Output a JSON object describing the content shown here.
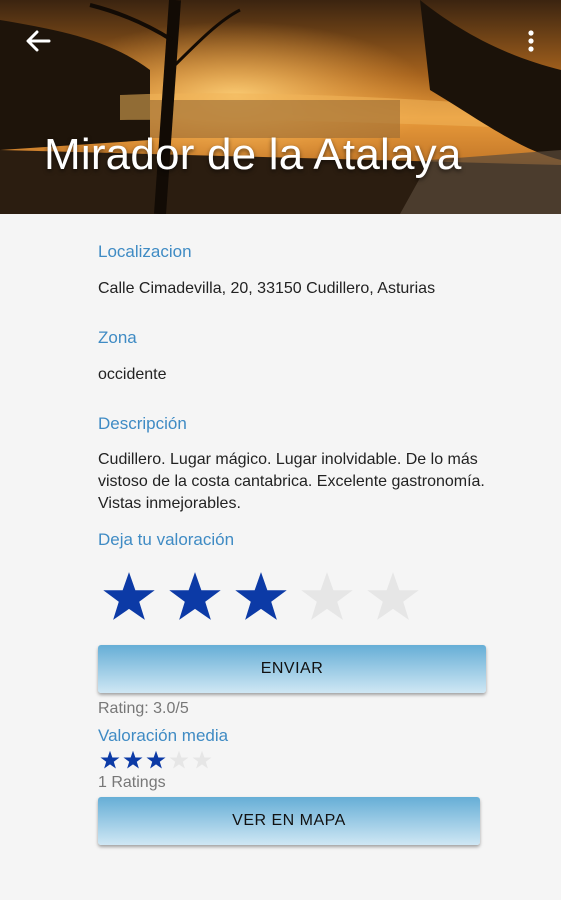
{
  "header": {
    "title": "Mirador de la Atalaya",
    "back_icon": "arrow-left-icon",
    "menu_icon": "more-vert-icon"
  },
  "details": {
    "location_label": "Localizacion",
    "location_value": "Calle Cimadevilla, 20, 33150 Cudillero, Asturias",
    "zone_label": "Zona",
    "zone_value": "occidente",
    "description_label": "Descripción",
    "description_value": "Cudillero. Lugar mágico. Lugar inolvidable. De lo más vistoso de la costa cantabrica. Excelente gastronomía. Vistas inmejorables."
  },
  "rating": {
    "prompt_label": "Deja tu valoración",
    "selected_stars": 3,
    "max_stars": 5,
    "submit_label": "ENVIAR",
    "rating_text": "Rating: 3.0/5"
  },
  "average": {
    "label": "Valoración media",
    "stars": 3,
    "count_text": "1 Ratings"
  },
  "map_button_label": "VER EN MAPA",
  "colors": {
    "accent": "#3f8bc4",
    "star_filled": "#0c3aa6",
    "star_empty": "#e6e6e6",
    "button_top": "#66aed6",
    "button_bottom": "#cfe7f4"
  }
}
